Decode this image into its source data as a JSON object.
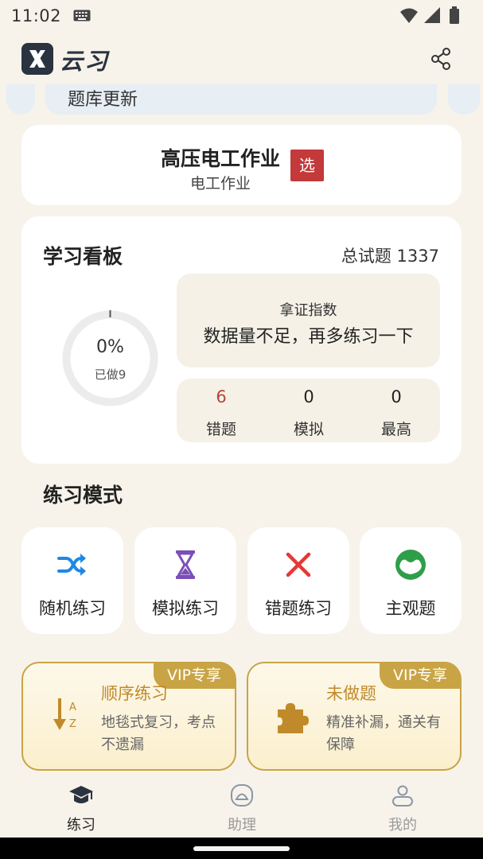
{
  "status_bar": {
    "time": "11:02"
  },
  "app": {
    "name": "云习"
  },
  "banner": {
    "text": "题库更新"
  },
  "subject": {
    "title": "高压电工作业",
    "subtitle": "电工作业",
    "select_label": "选"
  },
  "board": {
    "title": "学习看板",
    "total_label": "总试题 1337",
    "progress_percent": "0%",
    "progress_value": 0,
    "done_label": "已做9",
    "cert_title": "拿证指数",
    "cert_message": "数据量不足，再多练习一下",
    "stats": [
      {
        "value": "6",
        "label": "错题",
        "color": "#b5443e"
      },
      {
        "value": "0",
        "label": "模拟",
        "color": "#222222"
      },
      {
        "value": "0",
        "label": "最高",
        "color": "#222222"
      }
    ]
  },
  "practice": {
    "section_title": "练习模式",
    "modes": [
      {
        "label": "随机练习",
        "icon": "shuffle-icon",
        "color": "#1e88e5"
      },
      {
        "label": "模拟练习",
        "icon": "hourglass-icon",
        "color": "#7b4fb8"
      },
      {
        "label": "错题练习",
        "icon": "close-icon",
        "color": "#e53935"
      },
      {
        "label": "主观题",
        "icon": "face-icon",
        "color": "#2e9e4a"
      }
    ]
  },
  "vip": [
    {
      "tag": "VIP专享",
      "title": "顺序练习",
      "desc": "地毯式复习，考点不遗漏",
      "icon": "sort-az-icon"
    },
    {
      "tag": "VIP专享",
      "title": "未做题",
      "desc": "精准补漏，通关有保障",
      "icon": "puzzle-icon"
    }
  ],
  "nav": [
    {
      "label": "练习",
      "icon": "graduation-cap-icon",
      "active": true
    },
    {
      "label": "助理",
      "icon": "assistant-icon",
      "active": false
    },
    {
      "label": "我的",
      "icon": "user-icon",
      "active": false
    }
  ],
  "colors": {
    "background": "#f7f3ea",
    "vip_gold": "#c9a445",
    "accent_red": "#c4393a"
  }
}
